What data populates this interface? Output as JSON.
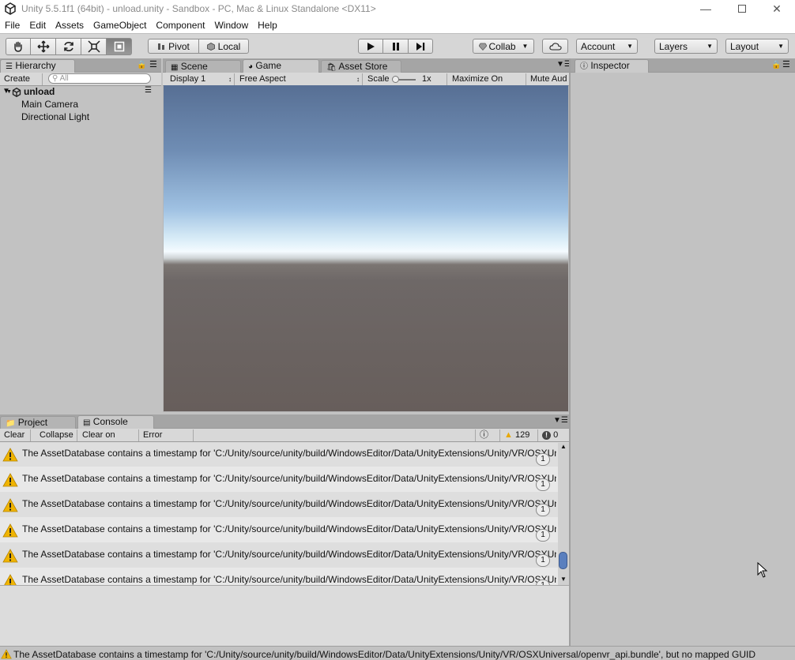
{
  "window": {
    "title": "Unity 5.5.1f1 (64bit) - unload.unity - Sandbox - PC, Mac & Linux Standalone <DX11>",
    "icon": "unity-logo-icon"
  },
  "menu": [
    "File",
    "Edit",
    "Assets",
    "GameObject",
    "Component",
    "Window",
    "Help"
  ],
  "toolbar": {
    "pivot_label": "Pivot",
    "local_label": "Local",
    "collab_label": "Collab",
    "account_label": "Account",
    "layers_label": "Layers",
    "layout_label": "Layout"
  },
  "hierarchy": {
    "tab_label": "Hierarchy",
    "create_label": "Create",
    "search_placeholder": "All",
    "scene_name": "unload",
    "items": [
      "Main Camera",
      "Directional Light"
    ]
  },
  "center_tabs": {
    "scene": "Scene",
    "game": "Game",
    "asset_store": "Asset Store"
  },
  "game_toolbar": {
    "display": "Display 1",
    "aspect": "Free Aspect",
    "scale_label": "Scale",
    "scale_value": "1x",
    "maximize": "Maximize On Play",
    "mute": "Mute Aud"
  },
  "inspector": {
    "tab_label": "Inspector"
  },
  "bottom_tabs": {
    "project": "Project",
    "console": "Console"
  },
  "console_toolbar": {
    "clear": "Clear",
    "collapse": "Collapse",
    "clear_on_play": "Clear on Play",
    "error_pause": "Error Pause",
    "info_count": "0",
    "warn_count": "129",
    "error_count": "0"
  },
  "console_messages": [
    {
      "text": "The AssetDatabase contains a timestamp for 'C:/Unity/source/unity/build/WindowsEditor/Data/UnityExtensions/Unity/VR/OSXUniversal/openvr_api.bundle', but no mapped GUID",
      "count": "1"
    },
    {
      "text": "The AssetDatabase contains a timestamp for 'C:/Unity/source/unity/build/WindowsEditor/Data/UnityExtensions/Unity/VR/OSXUniversal/openvr_api.bundle', but no mapped GUID",
      "count": "1"
    },
    {
      "text": "The AssetDatabase contains a timestamp for 'C:/Unity/source/unity/build/WindowsEditor/Data/UnityExtensions/Unity/VR/OSXUniversal/openvr_api.bundle', but no mapped GUID",
      "count": "1"
    },
    {
      "text": "The AssetDatabase contains a timestamp for 'C:/Unity/source/unity/build/WindowsEditor/Data/UnityExtensions/Unity/VR/OSXUniversal/openvr_api.bundle', but no mapped GUID",
      "count": "1"
    },
    {
      "text": "The AssetDatabase contains a timestamp for 'C:/Unity/source/unity/build/WindowsEditor/Data/UnityExtensions/Unity/VR/OSXUniversal/openvr_api.bundle', but no mapped GUID",
      "count": "1"
    },
    {
      "text": "The AssetDatabase contains a timestamp for 'C:/Unity/source/unity/build/WindowsEditor/Data/UnityExtensions/Unity/VR/OSXUniversal/openvr_api.bundle', but no mapped GUID",
      "count": "1"
    }
  ],
  "status_bar": {
    "text": "The AssetDatabase contains a timestamp for 'C:/Unity/source/unity/build/WindowsEditor/Data/UnityExtensions/Unity/VR/OSXUniversal/openvr_api.bundle', but no mapped GUID"
  }
}
